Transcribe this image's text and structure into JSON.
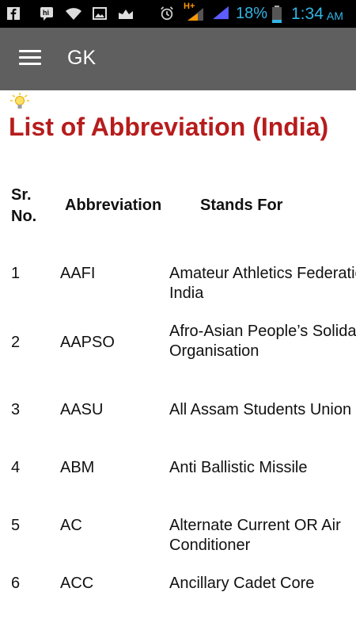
{
  "status_bar": {
    "network_label": "H+",
    "battery_percent": "18%",
    "time": "1:34",
    "ampm": "AM",
    "icons": [
      "facebook-icon",
      "hike-icon",
      "wifi-icon",
      "gallery-icon",
      "crown-notification-icon",
      "alarm-icon",
      "signal-icon",
      "signal-icon",
      "battery-icon"
    ]
  },
  "app_bar": {
    "title": "GK"
  },
  "page": {
    "title": "List of Abbreviation (India)",
    "icon": "lightbulb-icon"
  },
  "table": {
    "headers": {
      "sr": "Sr. No.",
      "abbr": "Abbreviation",
      "stands": "Stands For"
    },
    "rows": [
      {
        "sr": "1",
        "abbr": "AAFI",
        "stands": "Amateur Athletics Federation of India"
      },
      {
        "sr": "2",
        "abbr": "AAPSO",
        "stands": "Afro-Asian People’s Solidarity Organisation"
      },
      {
        "sr": "3",
        "abbr": "AASU",
        "stands": "All Assam Students Union"
      },
      {
        "sr": "4",
        "abbr": "ABM",
        "stands": "Anti Ballistic Missile"
      },
      {
        "sr": "5",
        "abbr": "AC",
        "stands": "Alternate Current OR Air Conditioner"
      },
      {
        "sr": "6",
        "abbr": "ACC",
        "stands": "Ancillary Cadet Core"
      }
    ]
  },
  "colors": {
    "title_red": "#b71c1c",
    "toolbar_gray": "#5f5f5f",
    "status_blue": "#33b5e5"
  }
}
